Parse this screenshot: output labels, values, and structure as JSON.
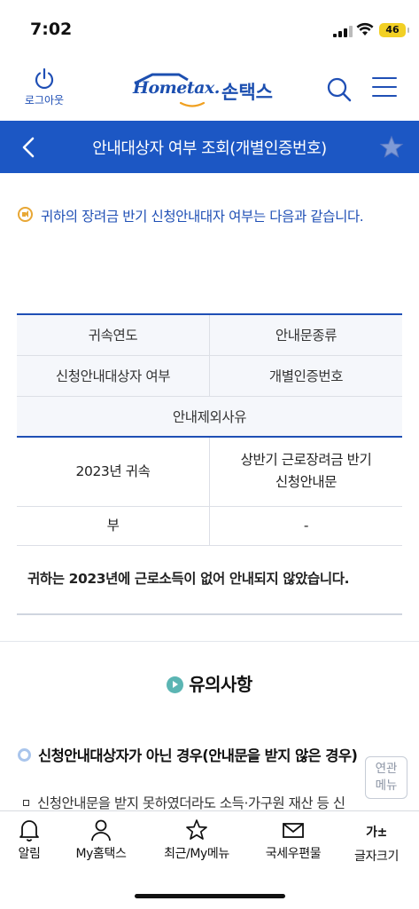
{
  "status_bar": {
    "time": "7:02",
    "battery": "46"
  },
  "header": {
    "logout_label": "로그아웃",
    "brand_en": "Hometax.",
    "brand_ko": "손택스",
    "icons": {
      "logout": "power-icon",
      "search": "search-icon",
      "menu": "hamburger-menu-icon"
    }
  },
  "title_bar": {
    "title": "안내대상자 여부 조회(개별인증번호)",
    "icons": {
      "back": "chevron-left-icon",
      "favorite": "star-icon"
    }
  },
  "notice": {
    "text": "귀하의 장려금 반기 신청안내대자 여부는 다음과 같습니다."
  },
  "table": {
    "headers": {
      "year": "귀속연도",
      "doc_type": "안내문종류",
      "target": "신청안내대상자 여부",
      "auth_no": "개별인증번호",
      "exclusion": "안내제외사유"
    },
    "row": {
      "year": "2023년 귀속",
      "doc_type_line1": "상반기 근로장려금 반기",
      "doc_type_line2": "신청안내문",
      "target": "부",
      "auth_no": "-",
      "exclusion": "귀하는 2023년에 근로소득이 없어 안내되지 않았습니다."
    }
  },
  "notes": {
    "section_title": "유의사항",
    "sub_title": "신청안내대상자가 아닌 경우(안내문을 받지 않은 경우)",
    "bullet": "신청안내문을 받지 못하였더라도 소득·가구원 재산 등 신"
  },
  "related_menu": {
    "line1": "연관",
    "line2": "메뉴"
  },
  "bottom_nav": [
    {
      "label": "알림",
      "icon": "bell-icon"
    },
    {
      "label": "My홈택스",
      "icon": "person-icon"
    },
    {
      "label": "최근/My메뉴",
      "icon": "star-icon"
    },
    {
      "label": "국세우편물",
      "icon": "mail-icon"
    },
    {
      "label": "글자크기",
      "icon": "font-size-icon",
      "glyph": "가±"
    }
  ],
  "colors": {
    "primary": "#1c57c4",
    "brand": "#1c4fb0",
    "notice_icon": "#e8a735",
    "teal": "#5bb5b3"
  }
}
